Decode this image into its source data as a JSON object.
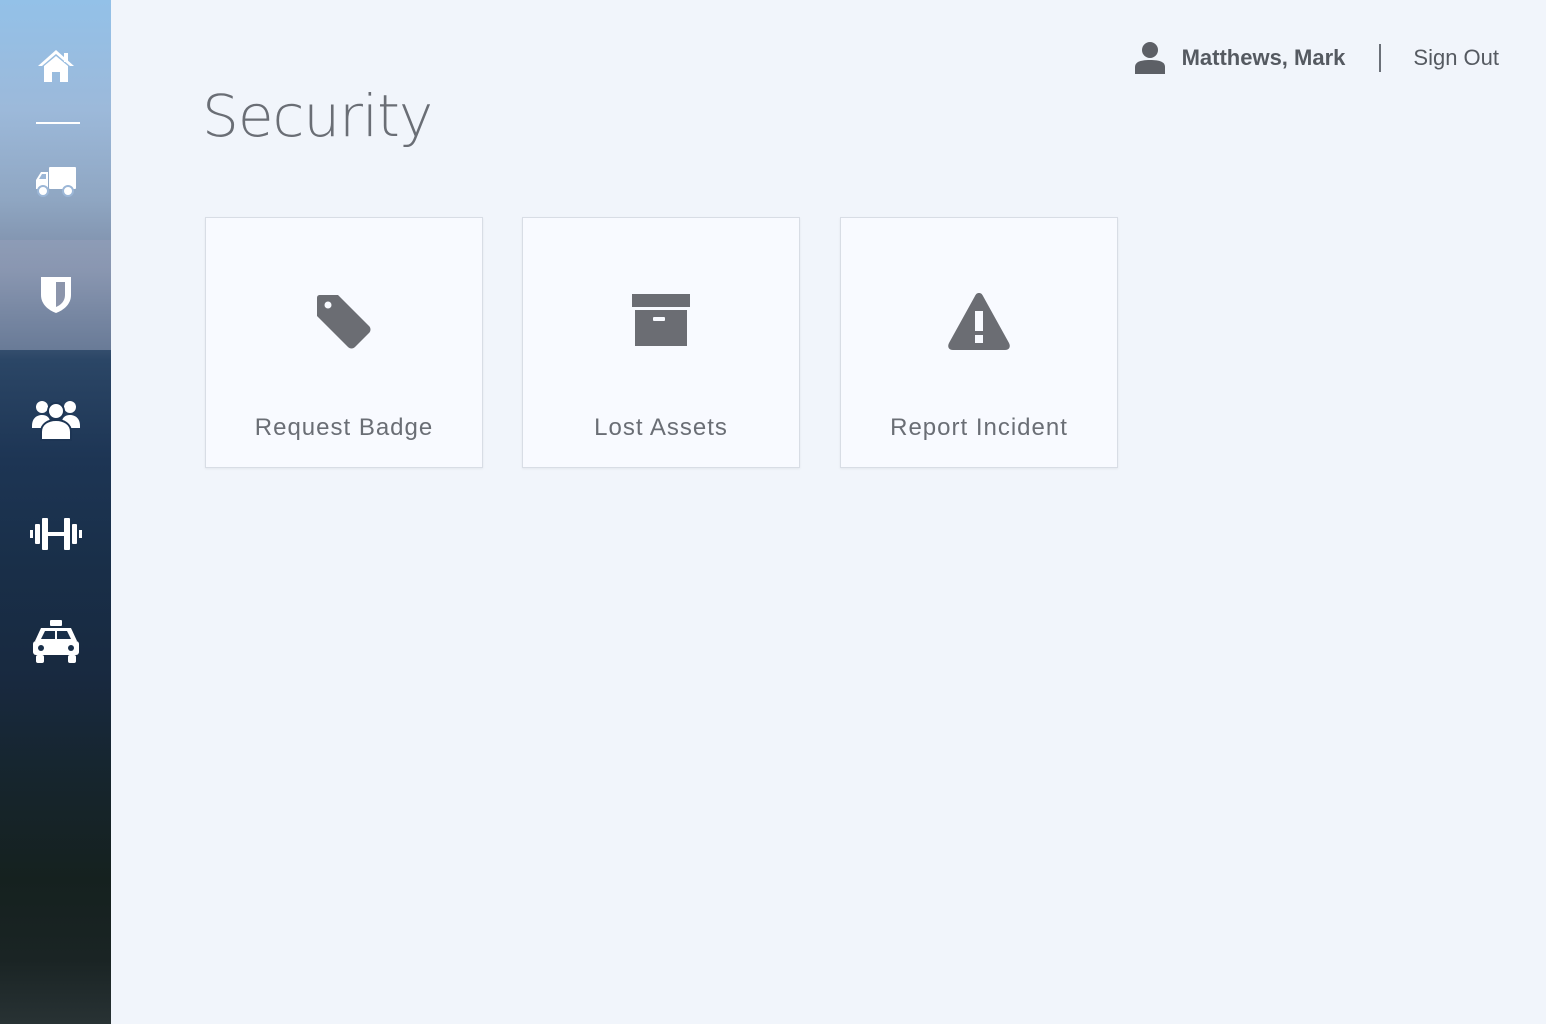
{
  "sidebar": {
    "items": [
      {
        "name": "home",
        "icon": "home-icon",
        "active": false
      },
      {
        "name": "shipping",
        "icon": "truck-icon",
        "active": false
      },
      {
        "name": "security",
        "icon": "shield-icon",
        "active": true
      },
      {
        "name": "people",
        "icon": "users-icon",
        "active": false
      },
      {
        "name": "fitness",
        "icon": "dumbbell-icon",
        "active": false
      },
      {
        "name": "taxi",
        "icon": "taxi-icon",
        "active": false
      }
    ]
  },
  "header": {
    "user_icon": "user-icon",
    "user_name": "Matthews, Mark",
    "sign_out_label": "Sign Out"
  },
  "page": {
    "title": "Security"
  },
  "cards": [
    {
      "label": "Request Badge",
      "icon": "tag-icon"
    },
    {
      "label": "Lost Assets",
      "icon": "archive-box-icon"
    },
    {
      "label": "Report Incident",
      "icon": "warning-icon"
    }
  ],
  "colors": {
    "background": "#f1f5fb",
    "card_background": "#f8faff",
    "icon_gray": "#6b6d73",
    "text_gray": "#6a6e75",
    "sidebar_top": "#93c1e8",
    "sidebar_bottom": "#283234"
  }
}
